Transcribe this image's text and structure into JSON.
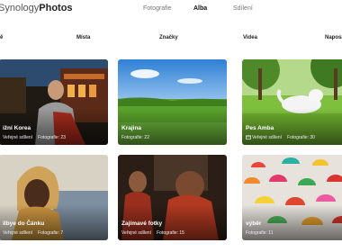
{
  "header": {
    "brand_first": "Synology",
    "brand_second": "Photos",
    "tabs": [
      "Fotografie",
      "Alba",
      "Sdílení"
    ],
    "active_tab": "Alba"
  },
  "chips": [
    "ě",
    "Místa",
    "Značky",
    "Videa",
    "Naposl"
  ],
  "albums": [
    {
      "title": "ižní Korea",
      "shared": "Veřejné sdílení",
      "count": "Fotografie: 23"
    },
    {
      "title": "Krajina",
      "shared": "",
      "count": "Fotografie: 22"
    },
    {
      "title": "Pes Amba",
      "shared": "Veřejné sdílení",
      "count": "Fotografie: 30"
    },
    {
      "title": "ilbye do Čánku",
      "shared": "Veřejné sdílení",
      "count": "Fotografie: 7"
    },
    {
      "title": "Zajímavé fotky",
      "shared": "Veřejné sdílení",
      "count": "Fotografie: 15"
    },
    {
      "title": "výběr",
      "shared": "",
      "count": "Fotografie: 11"
    }
  ],
  "colors": {
    "accent": "#1e8ce0",
    "text": "#222222"
  }
}
